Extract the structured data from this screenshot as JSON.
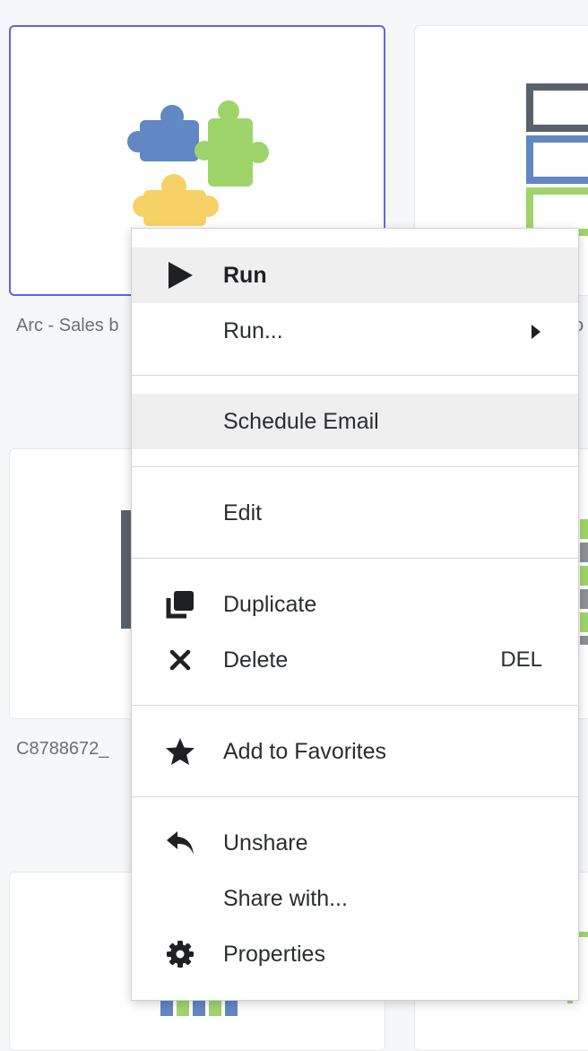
{
  "cards": {
    "card1_label": "Arc - Sales b",
    "card2_label": "C8788672_",
    "card_right_label_fragment": "o"
  },
  "menu": {
    "run": "Run",
    "run_submenu": "Run...",
    "schedule_email": "Schedule Email",
    "edit": "Edit",
    "duplicate": "Duplicate",
    "delete": "Delete",
    "delete_shortcut": "DEL",
    "add_to_favorites": "Add to Favorites",
    "unshare": "Unshare",
    "share_with": "Share with...",
    "properties": "Properties"
  },
  "colors": {
    "accent": "#5b66e6",
    "puzzle_blue": "#6187c4",
    "puzzle_green": "#9fd46b",
    "puzzle_yellow": "#f6d166",
    "highlight": "#efefef"
  }
}
